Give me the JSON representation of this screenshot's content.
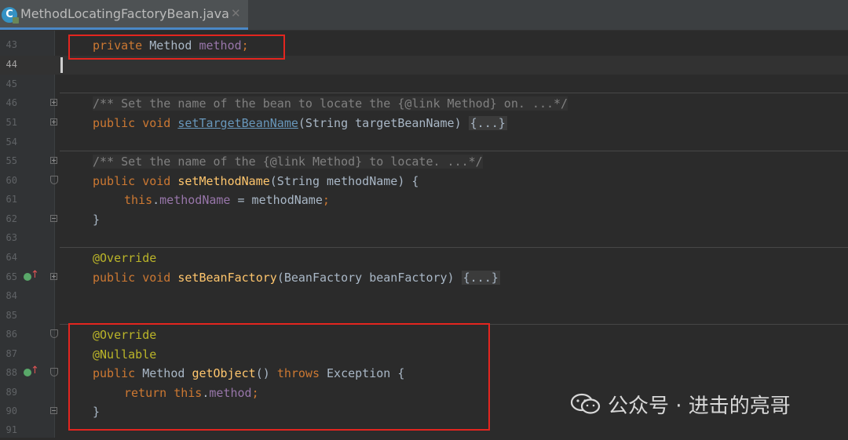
{
  "tab": {
    "icon_letter": "C",
    "title": "MethodLocatingFactoryBean.java",
    "close": "✕"
  },
  "lines": [
    {
      "num": "43"
    },
    {
      "num": "44"
    },
    {
      "num": "45"
    },
    {
      "num": "46"
    },
    {
      "num": "51"
    },
    {
      "num": "54"
    },
    {
      "num": "55"
    },
    {
      "num": "60"
    },
    {
      "num": "61"
    },
    {
      "num": "62"
    },
    {
      "num": "63"
    },
    {
      "num": "64"
    },
    {
      "num": "65"
    },
    {
      "num": "84"
    },
    {
      "num": "85"
    },
    {
      "num": "86"
    },
    {
      "num": "87"
    },
    {
      "num": "88"
    },
    {
      "num": "89"
    },
    {
      "num": "90"
    },
    {
      "num": "91"
    }
  ],
  "code": {
    "l43": {
      "kw": "private",
      "type": "Method",
      "field": "method",
      "semi": ";"
    },
    "l46": {
      "comment": "/** Set the name of the bean to locate the {@link Method} on. ...*/"
    },
    "l51": {
      "kw1": "public",
      "kw2": "void",
      "method": "setTargetBeanName",
      "params": "(String targetBeanName) ",
      "fold": "{...}"
    },
    "l55": {
      "comment": "/** Set the name of the {@link Method} to locate. ...*/"
    },
    "l60": {
      "kw1": "public",
      "kw2": "void",
      "method": "setMethodName",
      "params": "(String methodName) {"
    },
    "l61": {
      "kw": "this",
      "dot": ".",
      "field": "methodName",
      "rest": " = methodName",
      "semi": ";"
    },
    "l62": {
      "text": "}"
    },
    "l64": {
      "ann": "@Override"
    },
    "l65": {
      "kw1": "public",
      "kw2": "void",
      "method": "setBeanFactory",
      "params": "(BeanFactory beanFactory) ",
      "fold": "{...}"
    },
    "l86": {
      "ann": "@Override"
    },
    "l87": {
      "ann": "@Nullable"
    },
    "l88": {
      "kw1": "public",
      "type": "Method",
      "method": "getObject",
      "params": "() ",
      "kw2": "throws",
      "rest": " Exception {"
    },
    "l89": {
      "kw1": "return",
      "kw2": "this",
      "dot": ".",
      "field": "method",
      "semi": ";"
    },
    "l90": {
      "text": "}"
    }
  },
  "watermark": {
    "text": "公众号 · 进击的亮哥"
  },
  "colors": {
    "keyword": "#cc7832",
    "annotation": "#bbb529",
    "field": "#9876aa",
    "method": "#ffc66d",
    "comment": "#808080",
    "highlight_box": "#e3251f"
  }
}
